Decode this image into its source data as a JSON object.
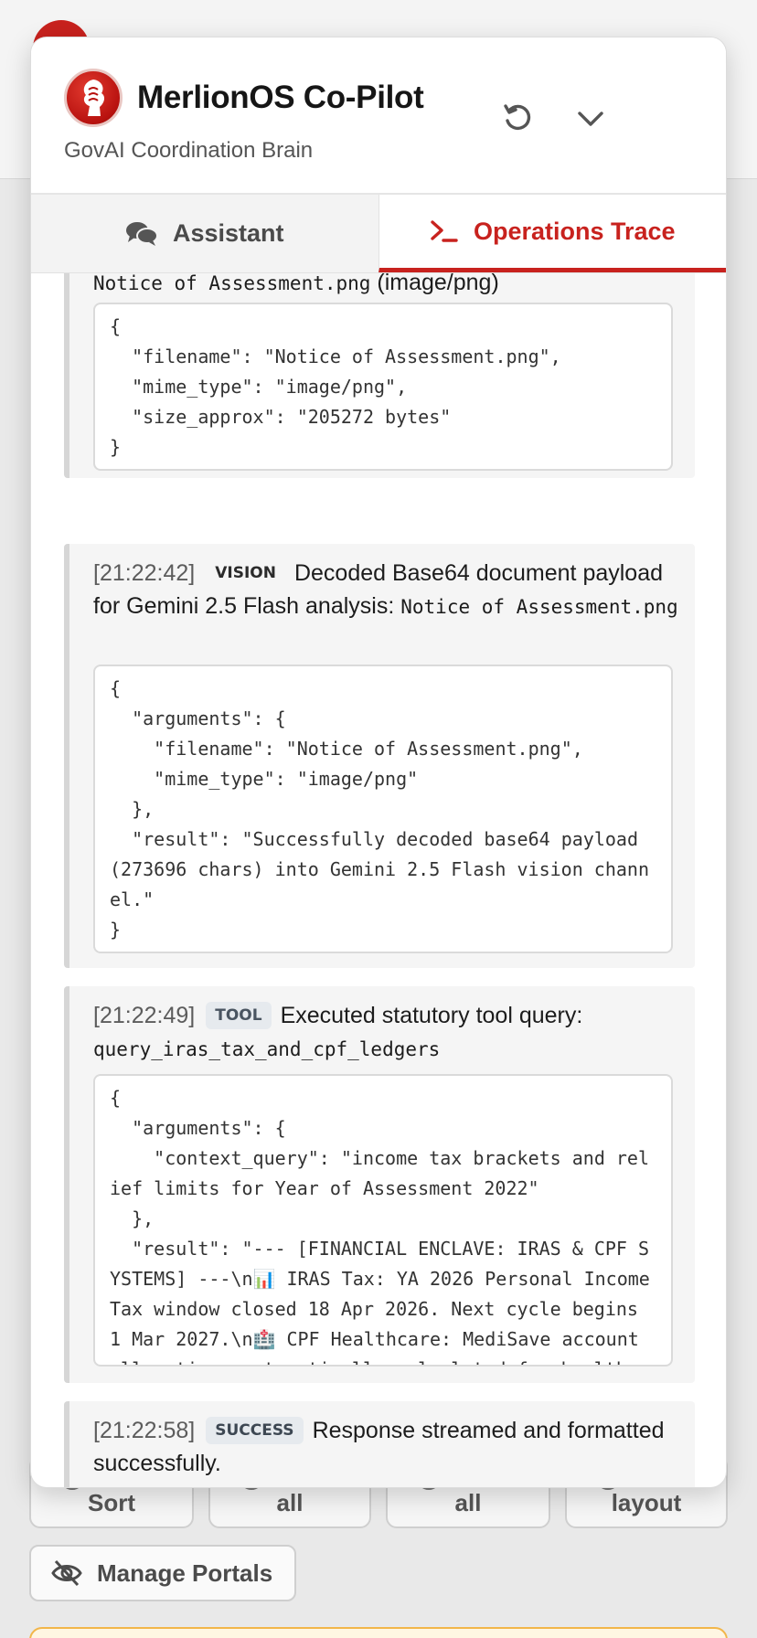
{
  "background": {
    "buttons": [
      "Sort",
      "all",
      "all",
      "layout"
    ],
    "manage_portals_label": "Manage Portals"
  },
  "panel": {
    "title": "MerlionOS Co-Pilot",
    "subtitle": "GovAI Coordination Brain",
    "tabs": [
      {
        "label": "Assistant",
        "icon": "chat-bubbles-icon",
        "active": false
      },
      {
        "label": "Operations Trace",
        "icon": "terminal-prompt-icon",
        "active": true
      }
    ]
  },
  "trace": {
    "entries": [
      {
        "partial_text": "Notice of Assessment.png",
        "partial_suffix": " (image/png)",
        "code": "{\n  \"filename\": \"Notice of Assessment.png\",\n  \"mime_type\": \"image/png\",\n  \"size_approx\": \"205272 bytes\"\n}"
      },
      {
        "time": "[21:22:42]",
        "tag": "VISION",
        "message": "Decoded Base64 document payload for Gemini 2.5 Flash analysis: ",
        "mono": "Notice of Assessment.png",
        "code": "{\n  \"arguments\": {\n    \"filename\": \"Notice of Assessment.png\",\n    \"mime_type\": \"image/png\"\n  },\n  \"result\": \"Successfully decoded base64 payload (273696 chars) into Gemini 2.5 Flash vision channel.\"\n}"
      },
      {
        "time": "[21:22:49]",
        "tag": "TOOL",
        "message": "Executed statutory tool query: ",
        "mono": "query_iras_tax_and_cpf_ledgers",
        "code": "{\n  \"arguments\": {\n    \"context_query\": \"income tax brackets and relief limits for Year of Assessment 2022\"\n  },\n  \"result\": \"--- [FINANCIAL ENCLAVE: IRAS & CPF SYSTEMS] ---\\n📊 IRAS Tax: YA 2026 Personal Income Tax window closed 18 Apr 2026. Next cycle begins 1 Mar 2027.\\n🏥 CPF Healthcare: MediSave account allocations automatically calculated for health"
      },
      {
        "time": "[21:22:58]",
        "tag": "SUCCESS",
        "message": "Response streamed and formatted successfully."
      }
    ]
  },
  "colors": {
    "accent": "#c8221e",
    "panel_bg": "#ffffff",
    "entry_bg": "#f5f5f5"
  }
}
